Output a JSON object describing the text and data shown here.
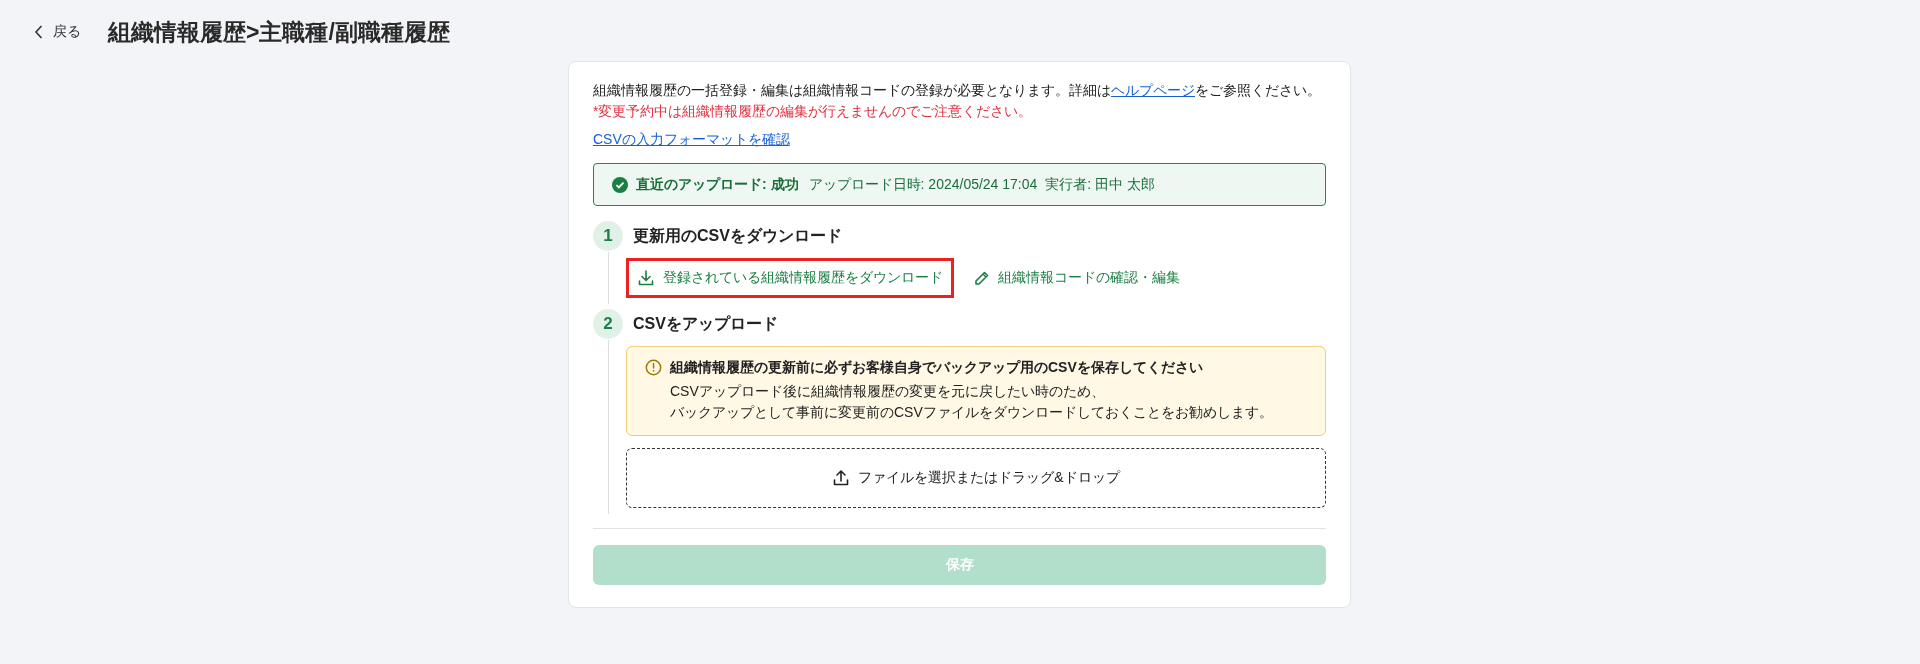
{
  "header": {
    "back_label": "戻る",
    "title": "組織情報履歴>主職種/副職種履歴"
  },
  "intro": {
    "text": "組織情報履歴の一括登録・編集は組織情報コードの登録が必要となります。詳細は",
    "link": "ヘルプページ",
    "text_after": "をご参照ください。"
  },
  "notice": "*変更予約中は組織情報履歴の編集が行えませんのでご注意ください。",
  "format_link": "CSVの入力フォーマットを確認",
  "status": {
    "kind": "success",
    "label": "直近のアップロード: 成功",
    "detail": "アップロード日時: 2024/05/24 17:04",
    "executor": "実行者: 田中 太郎"
  },
  "steps": [
    {
      "number": "1",
      "title": "更新用のCSVをダウンロード",
      "actions": [
        {
          "kind": "download",
          "label": "登録されている組織情報履歴をダウンロード",
          "highlighted": true
        },
        {
          "kind": "edit",
          "label": "組織情報コードの確認・編集",
          "highlighted": false
        }
      ]
    },
    {
      "number": "2",
      "title": "CSVをアップロード",
      "warning": {
        "title": "組織情報履歴の更新前に必ずお客様自身でバックアップ用のCSVを保存してください",
        "lines": [
          "CSVアップロード後に組織情報履歴の変更を元に戻したい時のため、",
          "バックアップとして事前に変更前のCSVファイルをダウンロードしておくことをお勧めします。"
        ]
      },
      "dropzone": {
        "label": "ファイルを選択またはドラッグ&ドロップ"
      }
    }
  ],
  "save_button": {
    "label": "保存",
    "disabled": true
  }
}
